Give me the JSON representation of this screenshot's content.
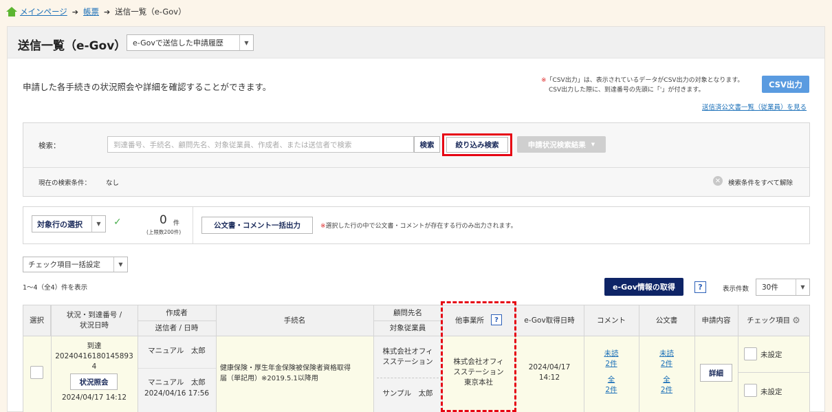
{
  "breadcrumb": {
    "home": "メインページ",
    "mid": "帳票",
    "current": "送信一覧（e-Gov）"
  },
  "header": {
    "title": "送信一覧（e-Gov）",
    "history_select": "e-Govで送信した申請履歴"
  },
  "intro": {
    "description": "申請した各手続きの状況照会や詳細を確認することができます。",
    "csv_note_mark": "※",
    "csv_note_1": "「CSV出力」は、表示されているデータがCSV出力の対象となります。",
    "csv_note_2": "CSV出力した際に、到達番号の先頭に「'」が付きます。",
    "csv_button": "CSV出力",
    "sent_docs_link": "送信済公文書一覧（従業員）を見る"
  },
  "search": {
    "label": "検索：",
    "placeholder": "到達番号、手続名、顧問先名、対象従業員、作成者、または送信者で検索",
    "search_button": "検索",
    "narrow_button": "絞り込み検索",
    "status_result_button": "申請状況検索結果",
    "cond_label": "現在の検索条件：",
    "cond_value": "なし",
    "clear_all": "検索条件をすべて解除"
  },
  "selection": {
    "target_select": "対象行の選択",
    "count": "0",
    "count_unit": "件",
    "count_limit": "(上限数200件)",
    "bulk_button": "公文書・コメント一括出力",
    "bulk_note_mark": "※",
    "bulk_note": "選択した行の中で公文書・コメントが存在する行のみ出力されます。"
  },
  "toolbar": {
    "check_bulk": "チェック項目一括設定",
    "range": "1～4（全4）件を表示",
    "egov_get": "e-Gov情報の取得",
    "help": "?",
    "per_page_label": "表示件数",
    "per_page": "30件"
  },
  "table": {
    "headers": {
      "select": "選択",
      "status_1": "状況・到達番号 /",
      "status_2": "状況日時",
      "creator": "作成者",
      "sender": "送信者 / 日時",
      "procedure": "手続名",
      "client": "顧問先名",
      "employee": "対象従業員",
      "other_office": "他事業所",
      "egov_date": "e-Gov取得日時",
      "comment": "コメント",
      "official_doc": "公文書",
      "application": "申請内容",
      "check_item": "チェック項目"
    },
    "row": {
      "status": "到達",
      "arrival_no_1": "20240416180145893",
      "arrival_no_2": "4",
      "status_button": "状況照会",
      "status_date": "2024/04/17 14:12",
      "creator": "マニュアル　太郎",
      "sender": "マニュアル　太郎",
      "sent_date": "2024/04/16 17:56",
      "procedure_1": "健康保険・厚生年金保険被保険者資格取得",
      "procedure_2": "届（単記用）※2019.5.1以降用",
      "client_1": "株式会社オフィ",
      "client_2": "スステーション",
      "employee": "サンプル　太郎",
      "office_1": "株式会社オフィ",
      "office_2": "スステーション",
      "office_3": "東京本社",
      "egov_date_1": "2024/04/17",
      "egov_date_2": "14:12",
      "comment_unread": "未読",
      "comment_unread_count": "2件",
      "comment_all": "全",
      "comment_all_count": "2件",
      "doc_unread": "未読",
      "doc_unread_count": "2件",
      "doc_all": "全",
      "doc_all_count": "2件",
      "detail_button": "詳細",
      "check_1": "未設定",
      "check_2": "未設定"
    }
  }
}
